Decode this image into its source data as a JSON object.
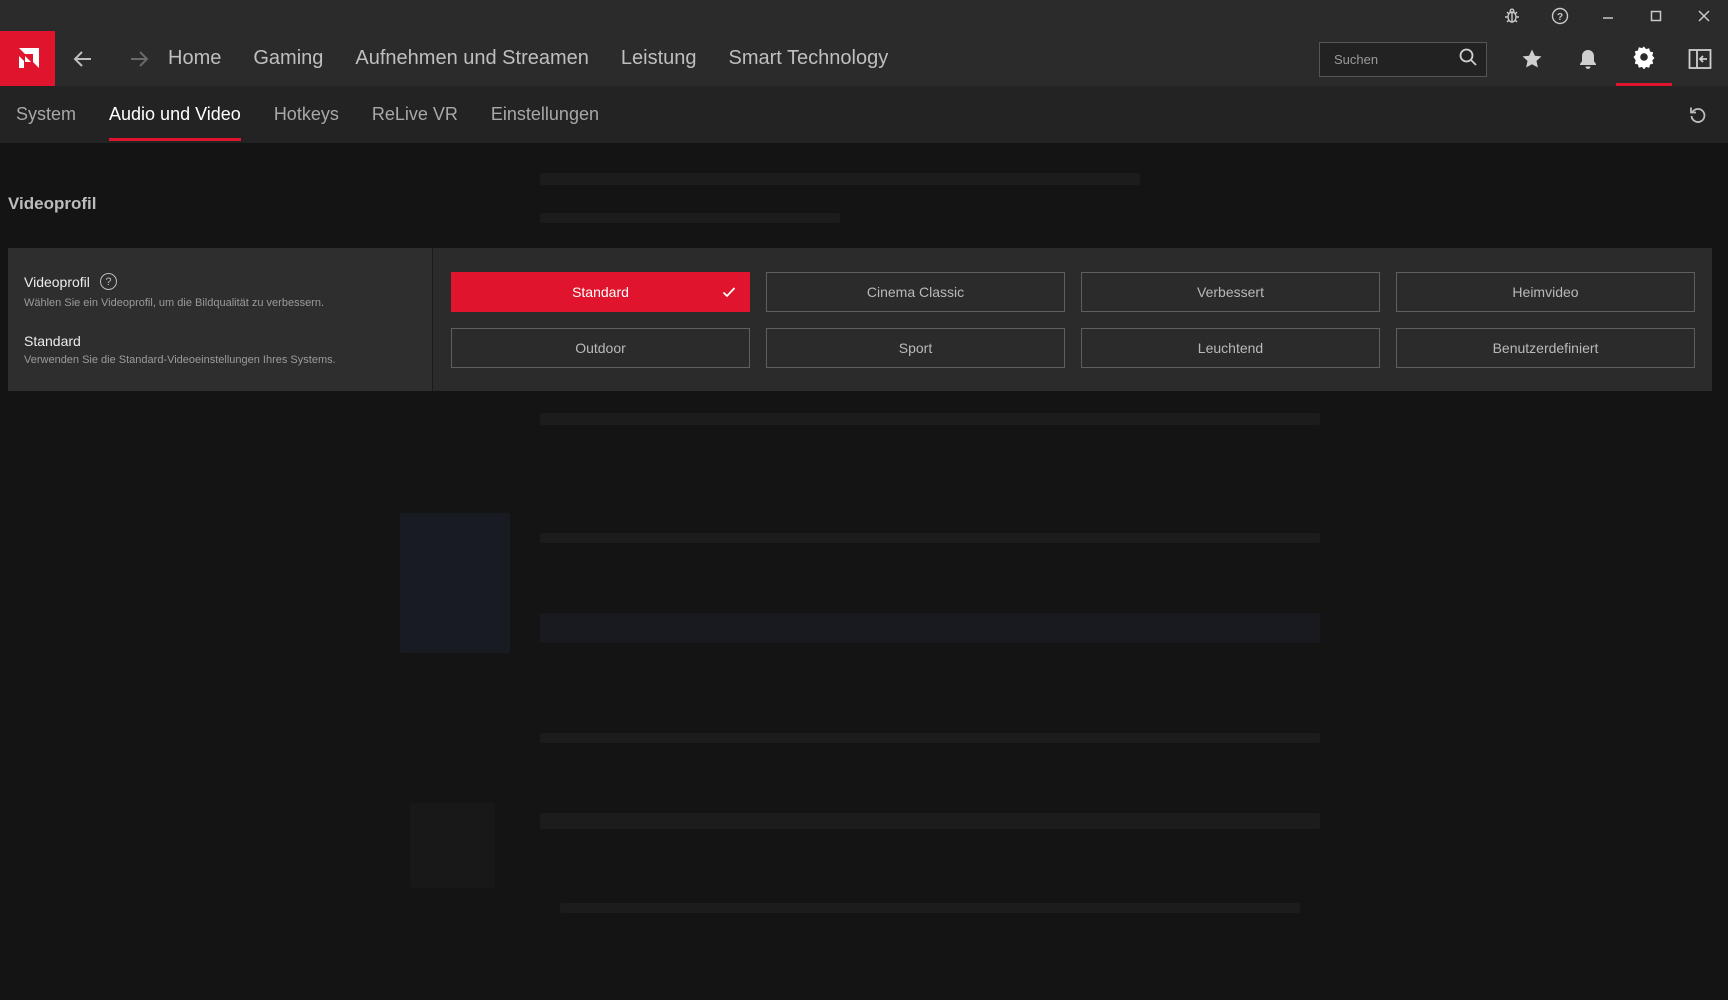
{
  "nav": {
    "items": [
      "Home",
      "Gaming",
      "Aufnehmen und Streamen",
      "Leistung",
      "Smart Technology"
    ]
  },
  "search": {
    "placeholder": "Suchen"
  },
  "subnav": {
    "tabs": [
      "System",
      "Audio und Video",
      "Hotkeys",
      "ReLive VR",
      "Einstellungen"
    ],
    "active_index": 1
  },
  "section": {
    "title": "Videoprofil"
  },
  "panel": {
    "title": "Videoprofil",
    "description": "Wählen Sie ein Videoprofil, um die Bildqualität zu verbessern.",
    "selected_title": "Standard",
    "selected_description": "Verwenden Sie die Standard-Videoeinstellungen Ihres Systems."
  },
  "profiles": [
    "Standard",
    "Cinema Classic",
    "Verbessert",
    "Heimvideo",
    "Outdoor",
    "Sport",
    "Leuchtend",
    "Benutzerdefiniert"
  ],
  "selected_profile": "Standard",
  "colors": {
    "accent": "#e0142c",
    "background": "#141414",
    "bar": "#2b2b2b"
  },
  "icons": {
    "titlebar": [
      "bug-report-icon",
      "help-icon",
      "minimize-icon",
      "maximize-icon",
      "close-icon"
    ],
    "topbar": [
      "amd-logo-icon",
      "back-arrow-icon",
      "forward-arrow-icon",
      "search-icon",
      "star-icon",
      "bell-icon",
      "gear-icon",
      "sidebar-toggle-icon",
      "reset-icon",
      "checkmark-icon"
    ]
  }
}
